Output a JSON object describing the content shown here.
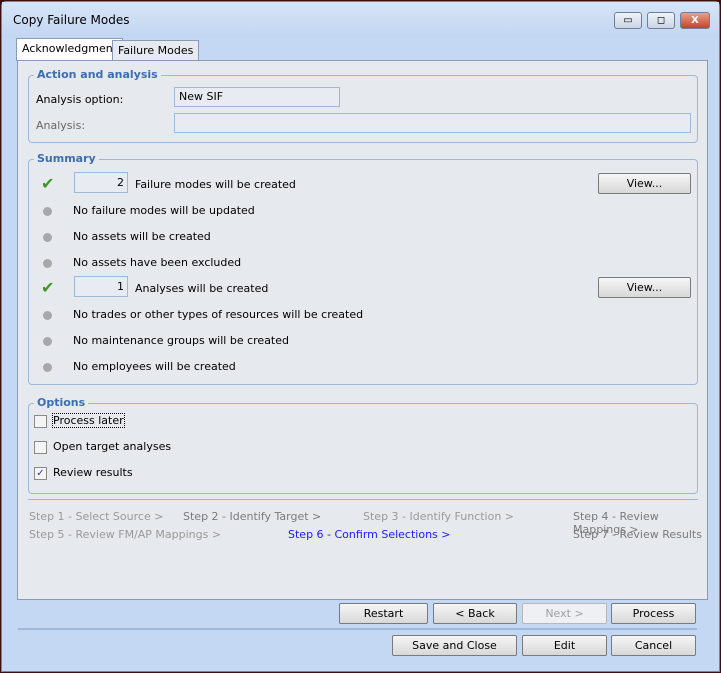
{
  "window": {
    "title": "Copy Failure Modes",
    "minimize": "▭",
    "maximize": "◻",
    "close": "X"
  },
  "tabs": [
    {
      "label": "Acknowledgment",
      "active": true
    },
    {
      "label": "Failure Modes",
      "active": false
    }
  ],
  "action": {
    "title": "Action and analysis",
    "option_label": "Analysis option:",
    "option_value": "New SIF",
    "analysis_label": "Analysis:",
    "analysis_value": ""
  },
  "summary": {
    "title": "Summary",
    "rows": [
      {
        "status": "check",
        "count": "2",
        "text": "Failure modes will be created",
        "button": "View..."
      },
      {
        "status": "dot",
        "text": "No failure modes will be updated"
      },
      {
        "status": "dot",
        "text": "No assets will be created"
      },
      {
        "status": "dot",
        "text": "No assets have been excluded"
      },
      {
        "status": "check",
        "count": "1",
        "text": "Analyses will be created",
        "button": "View..."
      },
      {
        "status": "dot",
        "text": "No trades or other types of resources will be created"
      },
      {
        "status": "dot",
        "text": "No maintenance groups will be created"
      },
      {
        "status": "dot",
        "text": "No employees will be created"
      }
    ]
  },
  "options": {
    "title": "Options",
    "items": [
      {
        "label": "Process later",
        "checked": false
      },
      {
        "label": "Open target analyses",
        "checked": false
      },
      {
        "label": "Review results",
        "checked": true
      }
    ]
  },
  "steps": [
    "Step 1 - Select Source >",
    "Step 2 - Identify Target >",
    "Step 3 - Identify Function >",
    "Step 4 - Review Mappings >",
    "Step 5 - Review FM/AP Mappings >",
    "Step 6 - Confirm Selections >",
    "Step 7 - Review Results"
  ],
  "wizard": {
    "restart": "Restart",
    "back": "< Back",
    "next": "Next >",
    "process": "Process"
  },
  "footer": {
    "save_close": "Save and Close",
    "edit": "Edit",
    "cancel": "Cancel"
  },
  "colors": {
    "accent": "#3d6eb3",
    "current_step": "#1a1aff",
    "check": "#3c9a2a"
  }
}
